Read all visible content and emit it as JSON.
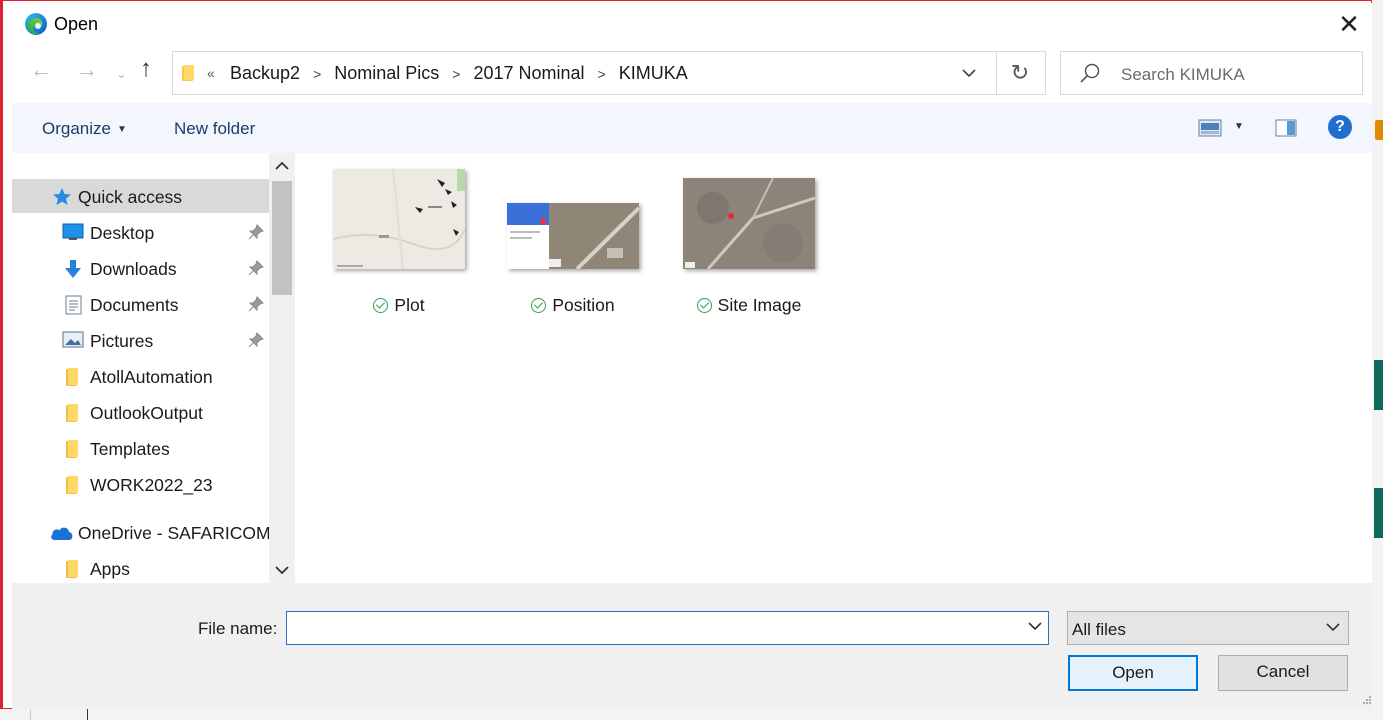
{
  "window": {
    "title": "Open"
  },
  "address": {
    "overflow": "«",
    "breadcrumbs": [
      "Backup2",
      "Nominal Pics",
      "2017 Nominal",
      "KIMUKA"
    ]
  },
  "search": {
    "placeholder": "Search KIMUKA"
  },
  "toolbar": {
    "organize": "Organize",
    "new_folder": "New folder"
  },
  "nav": {
    "quick_access": "Quick access",
    "items": [
      {
        "label": "Desktop",
        "pinned": true
      },
      {
        "label": "Downloads",
        "pinned": true
      },
      {
        "label": "Documents",
        "pinned": true
      },
      {
        "label": "Pictures",
        "pinned": true
      },
      {
        "label": "AtollAutomation",
        "pinned": false
      },
      {
        "label": "OutlookOutput",
        "pinned": false
      },
      {
        "label": "Templates",
        "pinned": false
      },
      {
        "label": "WORK2022_23",
        "pinned": false
      }
    ],
    "onedrive": "OneDrive - SAFARICOM",
    "onedrive_items": [
      {
        "label": "Apps"
      }
    ]
  },
  "files": [
    {
      "name": "Plot",
      "status": "synced"
    },
    {
      "name": "Position",
      "status": "synced"
    },
    {
      "name": "Site Image",
      "status": "synced"
    }
  ],
  "footer": {
    "file_name_label": "File name:",
    "file_name_value": "",
    "file_type": "All files",
    "open_label": "Open",
    "cancel_label": "Cancel"
  },
  "colors": {
    "accent": "#0078d7",
    "selection": "#d9d9d9",
    "border": "#d9242e",
    "link": "#1e3a6b"
  }
}
